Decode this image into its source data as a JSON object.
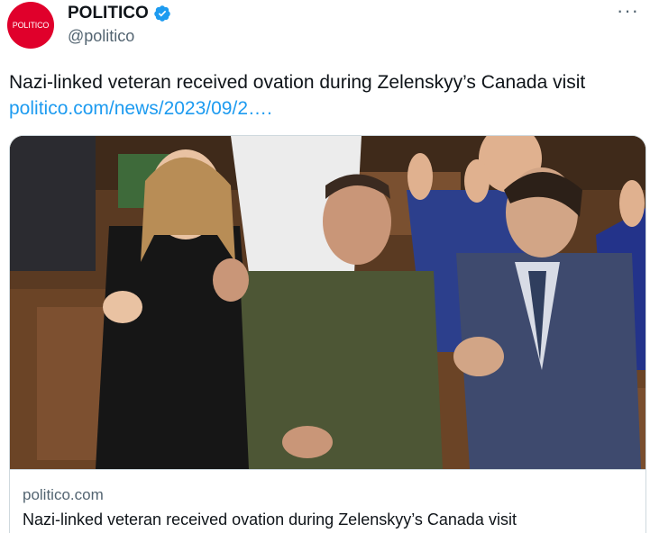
{
  "account": {
    "avatar_text": "POLITICO",
    "name": "POLITICO",
    "handle": "@politico",
    "verified_icon": "verified-badge-icon",
    "brand_color": "#e0002b"
  },
  "menu": {
    "more_label": "···"
  },
  "tweet": {
    "text": "Nazi-linked veteran received ovation during Zelenskyy’s Canada visit",
    "link_text": "politico.com/news/2023/09/2….",
    "link_color": "#1d9bf0"
  },
  "card": {
    "image_icon": "news-photo-image",
    "domain": "politico.com",
    "title": "Nazi-linked veteran received ovation during Zelenskyy’s Canada visit"
  }
}
